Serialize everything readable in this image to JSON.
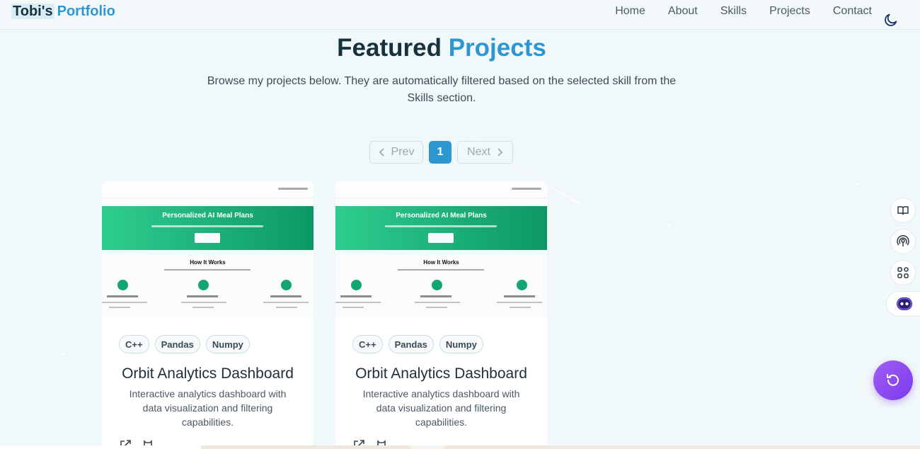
{
  "header": {
    "logo_part1": "Tobi's",
    "logo_part2": "Portfolio",
    "nav": [
      "Home",
      "About",
      "Skills",
      "Projects",
      "Contact"
    ],
    "theme_icon": "moon-icon"
  },
  "section": {
    "title_part1": "Featured",
    "title_part2": "Projects",
    "subtitle": "Browse my projects below. They are automatically filtered based on the selected skill from the Skills section."
  },
  "pagination": {
    "prev_label": "Prev",
    "current_page": "1",
    "next_label": "Next"
  },
  "projects": [
    {
      "thumb_hero_title": "Personalized AI Meal Plans",
      "thumb_section_title": "How It Works",
      "tags": [
        "C++",
        "Pandas",
        "Numpy"
      ],
      "title": "Orbit Analytics Dashboard",
      "description": "Interactive analytics dashboard with data visualization and filtering capabilities.",
      "link_icons": [
        "external-link-icon",
        "github-icon"
      ]
    },
    {
      "thumb_hero_title": "Personalized AI Meal Plans",
      "thumb_section_title": "How It Works",
      "tags": [
        "C++",
        "Pandas",
        "Numpy"
      ],
      "title": "Orbit Analytics Dashboard",
      "description": "Interactive analytics dashboard with data visualization and filtering capabilities.",
      "link_icons": [
        "external-link-icon",
        "github-icon"
      ]
    }
  ],
  "side_tools": [
    "book-icon",
    "broadcast-icon",
    "apps-grid-icon",
    "assistant-face-icon"
  ],
  "fab_icon": "refresh-icon",
  "colors": {
    "accent": "#2d97d2",
    "hero_green": "#1fb07a",
    "fab_purple": "#8a48f0"
  }
}
